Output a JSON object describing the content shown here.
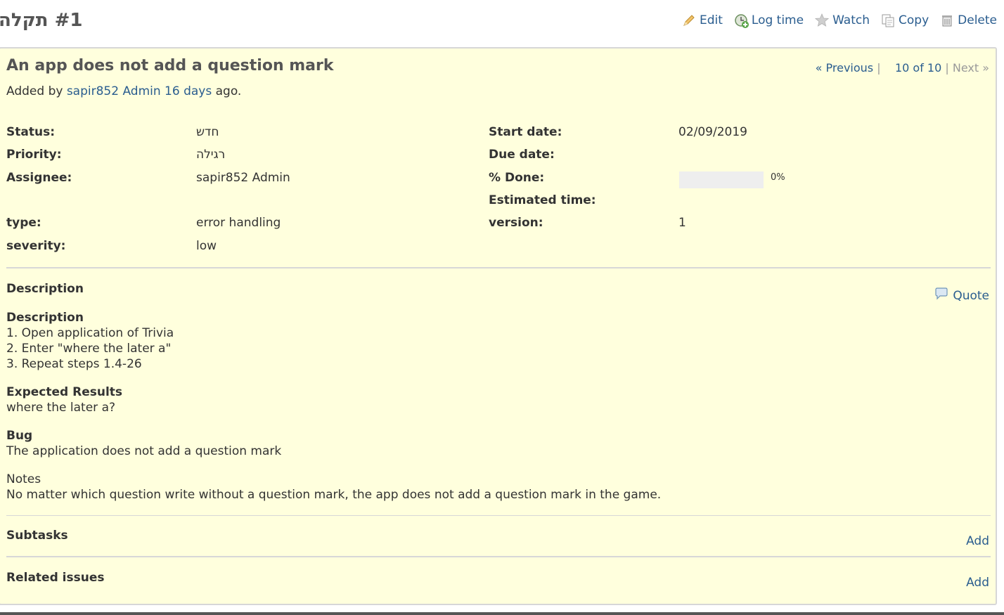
{
  "header": {
    "title": "#1 תקלה",
    "actions": [
      {
        "label": "Edit",
        "icon": "pencil-icon"
      },
      {
        "label": "Log time",
        "icon": "clock-add-icon"
      },
      {
        "label": "Watch",
        "icon": "star-icon"
      },
      {
        "label": "Copy",
        "icon": "copy-icon"
      },
      {
        "label": "Delete",
        "icon": "trash-icon"
      }
    ]
  },
  "issue": {
    "subject": "An app does not add a question mark",
    "author_prefix": "Added by",
    "author": "sapir852 Admin",
    "age": "16 days",
    "author_suffix": "ago.",
    "nav": {
      "previous": "« Previous",
      "separator": "|",
      "position": "10 of 10",
      "next": "Next »"
    },
    "attributes": {
      "status": {
        "label": "Status:",
        "value": "חדש"
      },
      "priority": {
        "label": "Priority:",
        "value": "רגילה"
      },
      "assignee": {
        "label": "Assignee:",
        "value": "sapir852 Admin"
      },
      "type": {
        "label": "type:",
        "value": "error handling"
      },
      "severity": {
        "label": "severity:",
        "value": "low"
      },
      "start_date": {
        "label": "Start date:",
        "value": "02/09/2019"
      },
      "due_date": {
        "label": "Due date:",
        "value": ""
      },
      "done": {
        "label": "% Done:",
        "value": "0%",
        "percent": 0
      },
      "estimated": {
        "label": "Estimated time:",
        "value": ""
      },
      "version": {
        "label": "version:",
        "value": "1"
      }
    },
    "description": {
      "title": "Description",
      "quote": "Quote",
      "heading1": "Description",
      "steps": [
        "1. Open application of Trivia",
        "2. Enter \"where the later a\"",
        "3. Repeat steps 1.4-26"
      ],
      "heading2": "Expected Results",
      "expected": "where the later a?",
      "heading3": "Bug",
      "bug": "The application does not add a question mark",
      "notes_title": "Notes",
      "notes": "No matter which question write without a question mark, the app does not add a question mark in the game."
    },
    "subtasks": {
      "title": "Subtasks",
      "add": "Add"
    },
    "related": {
      "title": "Related issues",
      "add": "Add"
    }
  },
  "colors": {
    "link": "#2a5d8f",
    "box_bg": "#ffffdd",
    "border": "#d7d7d7"
  }
}
